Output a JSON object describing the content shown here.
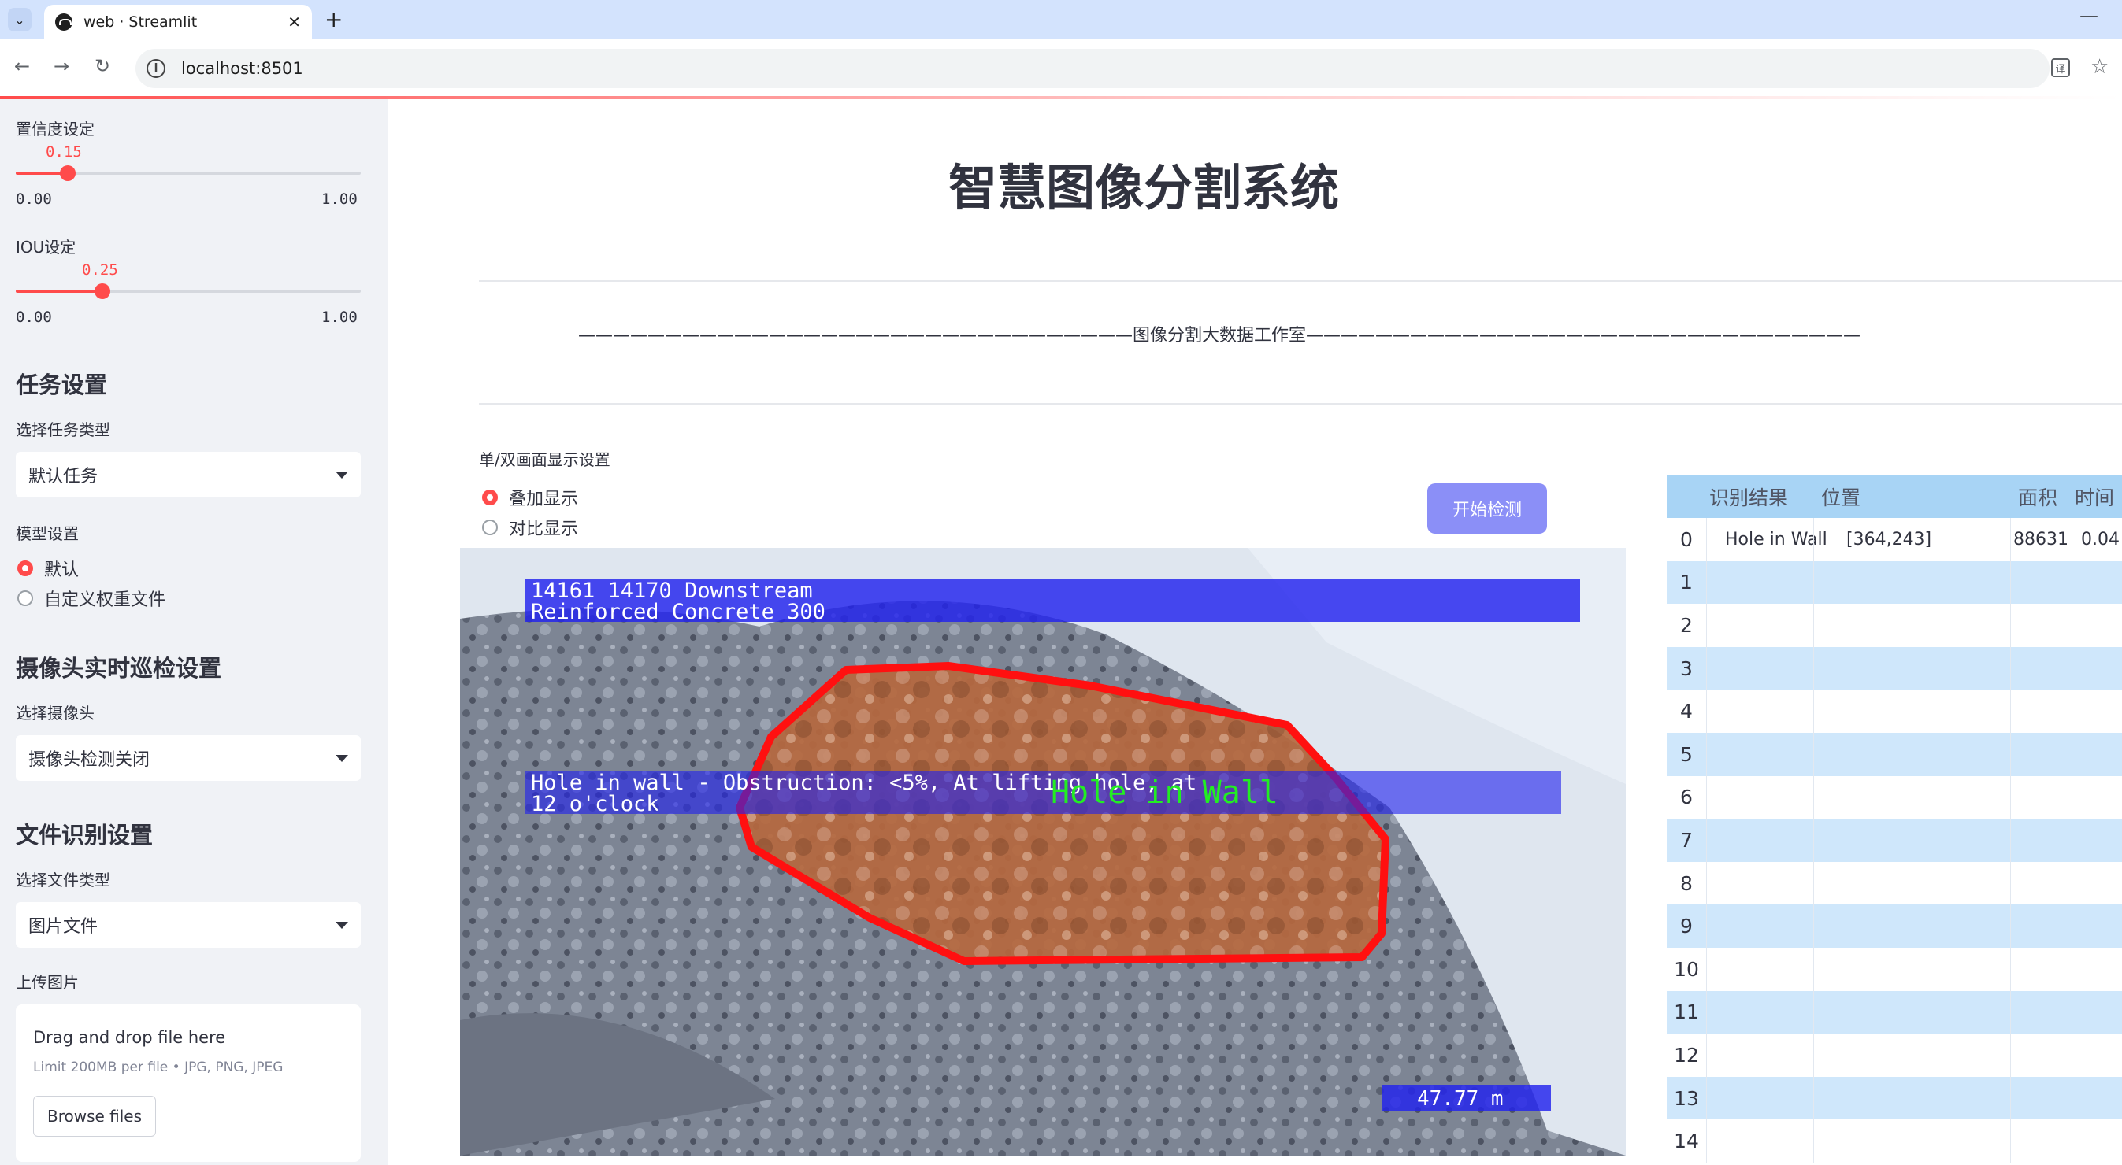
{
  "browser": {
    "tab_title": "web · Streamlit",
    "url": "localhost:8501",
    "tab_close": "✕",
    "new_tab": "+",
    "minimize": "—"
  },
  "sidebar": {
    "confidence": {
      "label": "置信度设定",
      "value": "0.15",
      "value_num": 0.15,
      "min": "0.00",
      "max": "1.00"
    },
    "iou": {
      "label": "IOU设定",
      "value": "0.25",
      "value_num": 0.25,
      "min": "0.00",
      "max": "1.00"
    },
    "task_section": {
      "title": "任务设置",
      "select_label": "选择任务类型",
      "selected": "默认任务"
    },
    "model_section": {
      "label": "模型设置",
      "options": [
        "默认",
        "自定义权重文件"
      ],
      "selected_index": 0
    },
    "camera_section": {
      "title": "摄像头实时巡检设置",
      "select_label": "选择摄像头",
      "selected": "摄像头检测关闭"
    },
    "file_section": {
      "title": "文件识别设置",
      "select_label": "选择文件类型",
      "selected": "图片文件"
    },
    "upload": {
      "label": "上传图片",
      "title": "Drag and drop file here",
      "subtitle": "Limit 200MB per file • JPG, PNG, JPEG",
      "button": "Browse files"
    }
  },
  "main": {
    "title": "智慧图像分割系统",
    "subtitle": "————————————————————————————————图像分割大数据工作室————————————————————————————————",
    "display_mode": {
      "label": "单/双画面显示设置",
      "options": [
        "叠加显示",
        "对比显示"
      ],
      "selected_index": 0
    },
    "start_button": "开始检测"
  },
  "image": {
    "overlay_line1": "14161 14170 Downstream",
    "overlay_line2": "Reinforced Concrete 300",
    "overlay_line3": "Hole in wall - Obstruction: <5%, At lifting hole, at",
    "overlay_line4": "12 o'clock",
    "detection_label": "Hole in Wall",
    "distance": "47.77 m"
  },
  "results_table": {
    "headers": [
      "",
      "识别结果",
      "位置",
      "面积",
      "时间"
    ],
    "rows": [
      {
        "index": "0",
        "result": "Hole in Wall",
        "position": "[364,243]",
        "area": "88631",
        "time": "0.04"
      },
      {
        "index": "1"
      },
      {
        "index": "2"
      },
      {
        "index": "3"
      },
      {
        "index": "4"
      },
      {
        "index": "5"
      },
      {
        "index": "6"
      },
      {
        "index": "7"
      },
      {
        "index": "8"
      },
      {
        "index": "9"
      },
      {
        "index": "10"
      },
      {
        "index": "11"
      },
      {
        "index": "12"
      },
      {
        "index": "13"
      },
      {
        "index": "14"
      }
    ]
  },
  "colors": {
    "accent": "#ff4b4b",
    "sidebar_bg": "#f0f2f6",
    "button": "#8b8ff7",
    "table_header": "#a8d4f5",
    "table_alt": "#cfe7fb",
    "mask": "#b5612f",
    "contour": "#ff1010"
  }
}
